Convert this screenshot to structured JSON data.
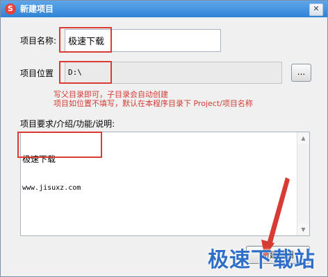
{
  "window": {
    "title": "新建项目",
    "app_icon": "S",
    "close_glyph": "✕"
  },
  "form": {
    "name_label": "项目名称",
    "name_value": "极速下载",
    "location_label": "项目位置",
    "location_value": "D:\\",
    "browse_label": "...",
    "hint_line1": "写父目录即可，子目录会自动创建",
    "hint_line2": "项目如位置不填写，默认在本程序目录下 Project/项目名称",
    "requirements_label": "项目要求/介绍/功能/说明:",
    "requirements_line1": "极速下载",
    "requirements_line2": "www.jisuxz.com"
  },
  "buttons": {
    "create_label": "新建项目"
  },
  "watermark": "极速下载站",
  "colors": {
    "titlebar": "#3a8ddc",
    "highlight": "#d83a34",
    "hint_text": "#d43a34",
    "watermark": "#2f6fc7"
  },
  "icons": {
    "app": "app-logo-icon",
    "close": "close-icon",
    "scroll_up": "scroll-up-icon",
    "scroll_down": "scroll-down-icon"
  }
}
